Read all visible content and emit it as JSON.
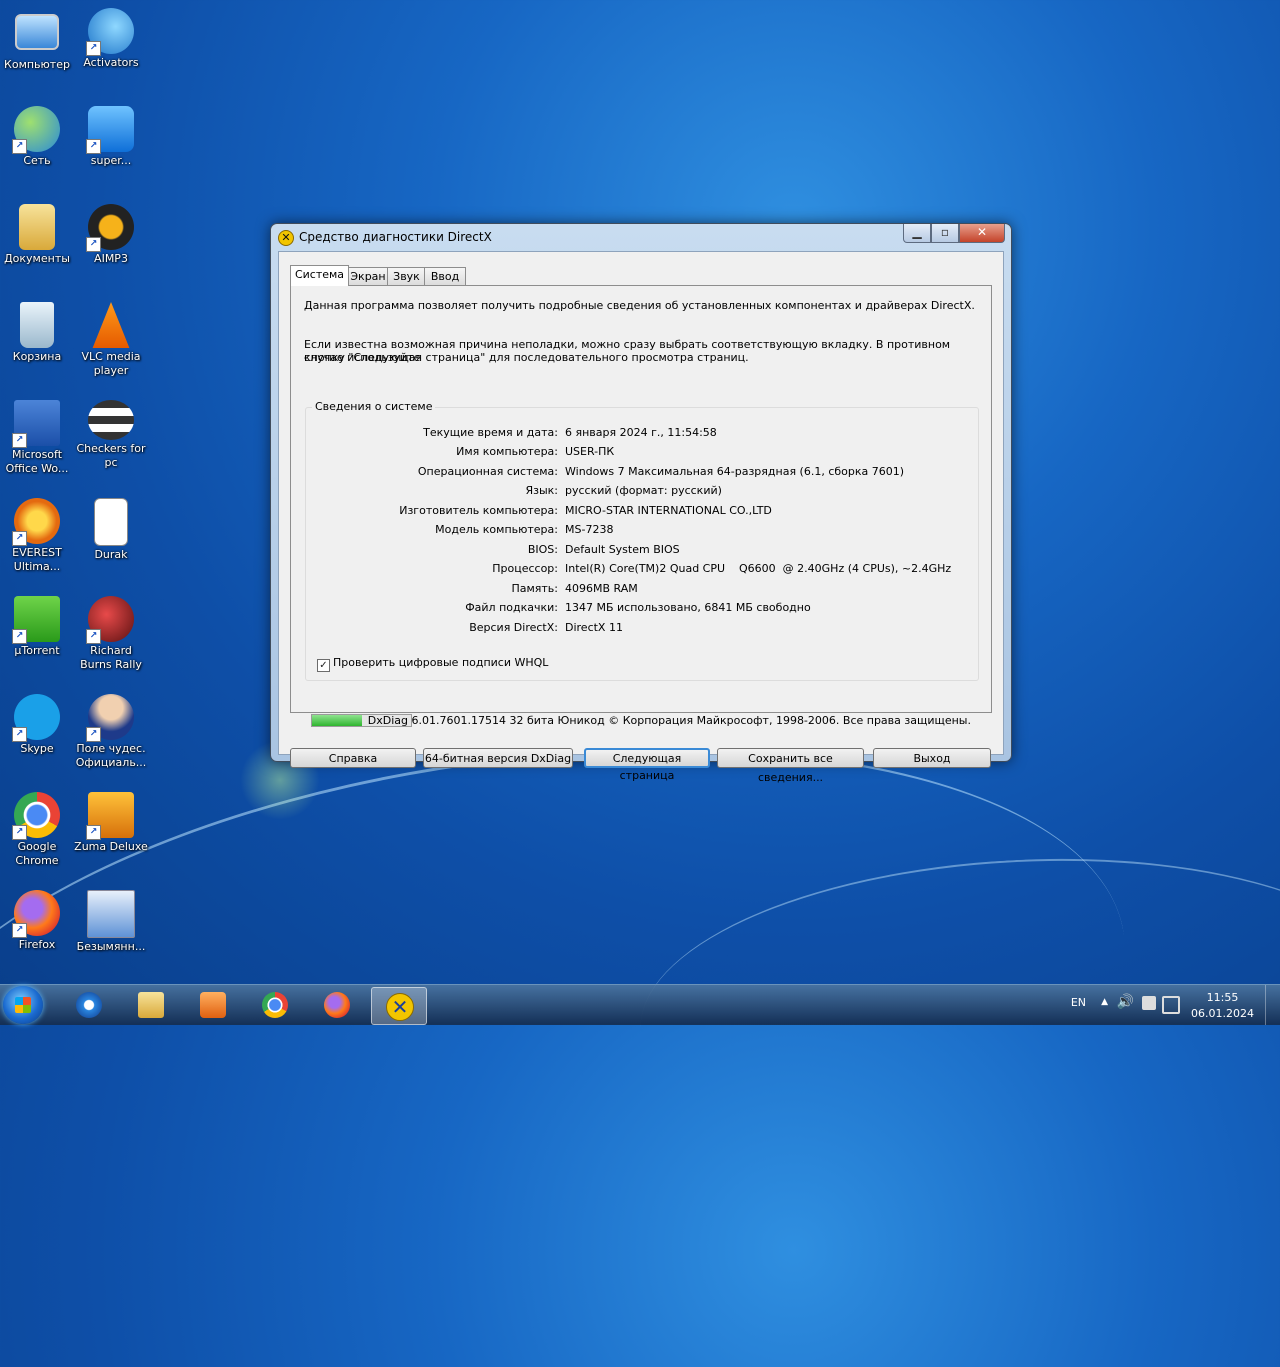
{
  "desktop": {
    "icons": [
      {
        "label": "Компьютер",
        "icon": "computer-icon"
      },
      {
        "label": "Activators",
        "icon": "activators-icon"
      },
      {
        "label": "Сеть",
        "icon": "network-icon"
      },
      {
        "label": "super...",
        "icon": "teamviewer-icon"
      },
      {
        "label": "Документы",
        "icon": "documents-folder-icon"
      },
      {
        "label": "AIMP3",
        "icon": "aimp-icon"
      },
      {
        "label": "Корзина",
        "icon": "recycle-bin-icon"
      },
      {
        "label": "VLC media\nplayer",
        "icon": "vlc-icon"
      },
      {
        "label": "Microsoft\nOffice Wo...",
        "icon": "word-icon"
      },
      {
        "label": "Checkers for\npc",
        "icon": "checkers-icon"
      },
      {
        "label": "EVEREST\nUltima...",
        "icon": "everest-icon"
      },
      {
        "label": "Durak",
        "icon": "durak-card-icon"
      },
      {
        "label": "µTorrent",
        "icon": "utorrent-icon"
      },
      {
        "label": "Richard\nBurns Rally",
        "icon": "rally-helmet-icon"
      },
      {
        "label": "Skype",
        "icon": "skype-icon"
      },
      {
        "label": "Поле чудес.\nОфициаль...",
        "icon": "pole-chudes-icon"
      },
      {
        "label": "Google\nChrome",
        "icon": "chrome-icon"
      },
      {
        "label": "Zuma Deluxe",
        "icon": "zuma-icon"
      },
      {
        "label": "Firefox",
        "icon": "firefox-icon"
      },
      {
        "label": "Безымянн...",
        "icon": "image-file-icon"
      }
    ]
  },
  "window": {
    "title": "Средство диагностики DirectX",
    "app_icon": "directx-icon",
    "controls": {
      "minimize": "minimize-icon",
      "maximize": "maximize-icon",
      "close": "close-icon"
    },
    "tabs": [
      "Система",
      "Экран",
      "Звук",
      "Ввод"
    ],
    "intro1": "Данная программа позволяет получить подробные сведения об установленных компонентах и драйверах DirectX.",
    "intro2a": "Если известна возможная причина неполадки, можно сразу выбрать соответствующую вкладку. В противном случае используйте",
    "intro2b": "кнопку \"Следующая страница\" для последовательного просмотра страниц.",
    "group_title": "Сведения о системе",
    "info": [
      {
        "key": "Текущие время и дата:",
        "value": "6 января 2024 г., 11:54:58"
      },
      {
        "key": "Имя компьютера:",
        "value": "USER-ПК"
      },
      {
        "key": "Операционная система:",
        "value": "Windows 7 Максимальная 64-разрядная (6.1, сборка 7601)"
      },
      {
        "key": "Язык:",
        "value": "русский (формат: русский)"
      },
      {
        "key": "Изготовитель компьютера:",
        "value": "MICRO-STAR INTERNATIONAL CO.,LTD"
      },
      {
        "key": "Модель компьютера:",
        "value": "MS-7238"
      },
      {
        "key": "BIOS:",
        "value": "Default System BIOS"
      },
      {
        "key": "Процессор:",
        "value": "Intel(R) Core(TM)2 Quad CPU    Q6600  @ 2.40GHz (4 CPUs), ~2.4GHz"
      },
      {
        "key": "Память:",
        "value": "4096MB RAM"
      },
      {
        "key": "Файл подкачки:",
        "value": "1347 МБ использовано, 6841 МБ свободно"
      },
      {
        "key": "Версия DirectX:",
        "value": "DirectX 11"
      }
    ],
    "whql_label": "Проверить цифровые подписи WHQL",
    "whql_checked": true,
    "progress": 0.5,
    "copyright": "DxDiag 6.01.7601.17514 32 бита Юникод  © Корпорация Майкрософт, 1998-2006.  Все права защищены.",
    "buttons": {
      "help": "Справка",
      "dxdiag64": "64-битная версия DxDiag",
      "next": "Следующая страница",
      "save": "Сохранить все сведения...",
      "exit": "Выход"
    }
  },
  "taskbar": {
    "pinned": [
      {
        "icon": "internet-explorer-icon"
      },
      {
        "icon": "explorer-folder-icon"
      },
      {
        "icon": "media-player-icon"
      },
      {
        "icon": "chrome-icon"
      },
      {
        "icon": "firefox-icon"
      },
      {
        "icon": "directx-icon"
      }
    ],
    "language": "EN",
    "time": "11:55",
    "date": "06.01.2024",
    "colors": {
      "accent": "#1767c4",
      "progress": "#2fb52f"
    }
  }
}
